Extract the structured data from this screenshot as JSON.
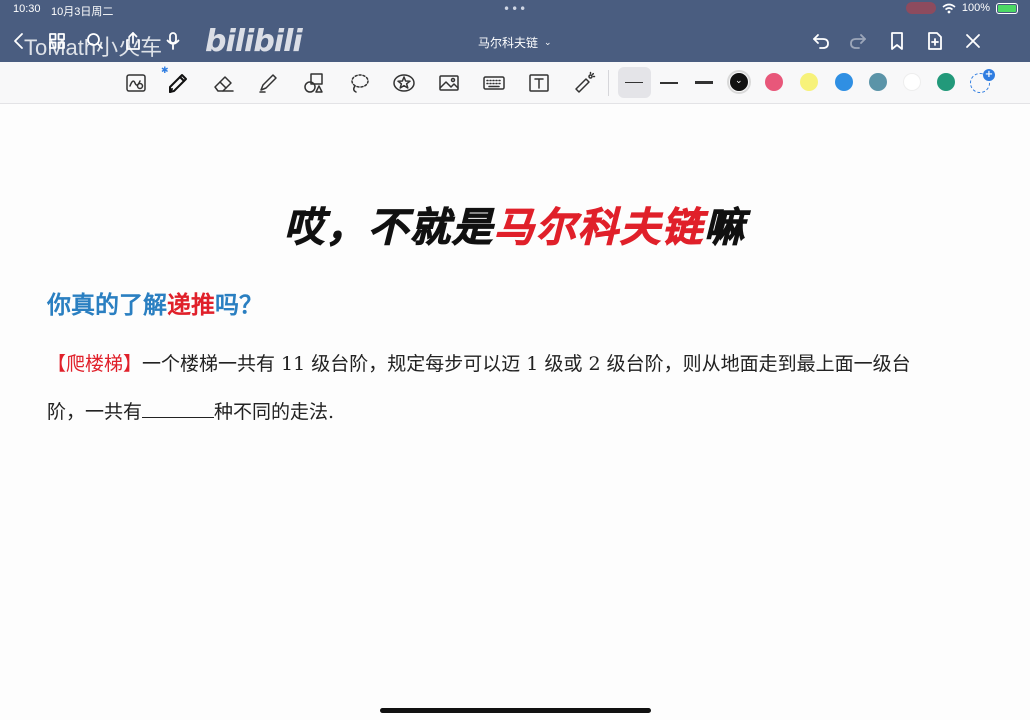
{
  "status_bar": {
    "time": "10:30",
    "date": "10月3日周二",
    "dots": "•••",
    "battery": "100%"
  },
  "app_bar": {
    "watermark": "ToMath小火车",
    "bilibili": "bilibili",
    "document_title": "马尔科夫链",
    "title_chevron": "⌄",
    "icons": [
      "back-icon",
      "grid-icon",
      "search-icon",
      "share-icon",
      "mic-icon",
      "undo-icon",
      "redo-icon",
      "bookmark-icon",
      "add-page-icon",
      "close-icon"
    ]
  },
  "toolbar": {
    "tools": [
      "handwriting-search-icon",
      "pen-icon",
      "eraser-icon",
      "highlighter-icon",
      "shapes-icon",
      "lasso-icon",
      "sticker-icon",
      "image-icon",
      "keyboard-icon",
      "textbox-icon",
      "laser-pointer-icon"
    ],
    "bluetooth_mark": "✱",
    "stroke_widths": [
      "thin",
      "medium",
      "thick"
    ],
    "colors": [
      "#111111",
      "#e8577a",
      "#f7f27a",
      "#2f8fe3",
      "#5b94a8",
      "#ffffff",
      "#22997a"
    ],
    "selected_color": "#111111",
    "add_color_label": "+"
  },
  "content": {
    "headline_dark_1": "哎，不就是",
    "headline_red": "马尔科夫链",
    "headline_dark_2": "嘛",
    "subtitle_a": "你真的了解",
    "subtitle_red": "递推",
    "subtitle_b": "吗？",
    "problem_tag": "【爬楼梯】",
    "problem_line1": "一个楼梯一共有 11 级台阶，规定每步可以迈 1 级或 2 级台阶，则从地面走到最上面一级台",
    "problem_line2_a": "阶，一共有",
    "problem_line2_b": "种不同的走法."
  }
}
